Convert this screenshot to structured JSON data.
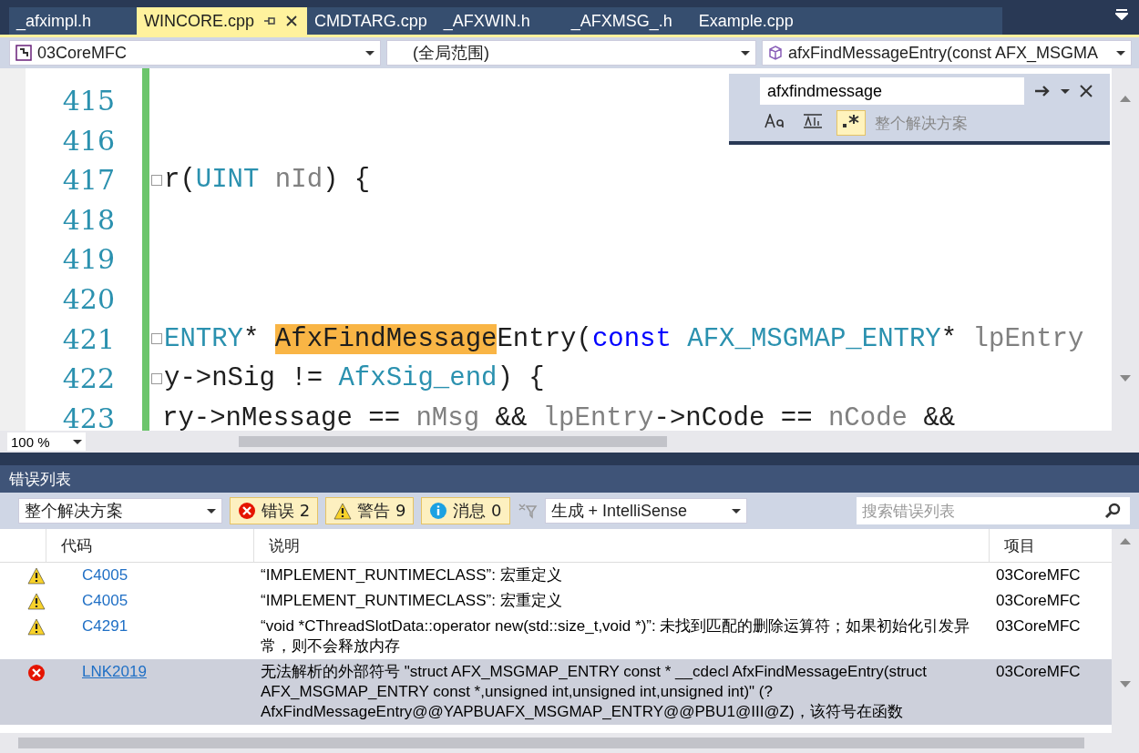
{
  "tabs": [
    {
      "label": "_afximpl.h",
      "selected": false
    },
    {
      "label": "WINCORE.cpp",
      "selected": true
    },
    {
      "label": "CMDTARG.cpp",
      "selected": false
    },
    {
      "label": "_AFXWIN.h",
      "selected": false
    },
    {
      "label": "_AFXMSG_.h",
      "selected": false
    },
    {
      "label": "Example.cpp",
      "selected": false
    }
  ],
  "nav": {
    "project": "03CoreMFC",
    "scope": "(全局范围)",
    "member": "afxFindMessageEntry(const AFX_MSGMA"
  },
  "editor": {
    "zoom": "100 %",
    "lines": [
      {
        "number": "415",
        "fold": false
      },
      {
        "number": "416",
        "fold": false
      },
      {
        "number": "417",
        "fold": true,
        "segments": [
          {
            "kind": "plain",
            "text": "r("
          },
          {
            "kind": "type",
            "text": "UINT"
          },
          {
            "kind": "param",
            "text": " nId"
          },
          {
            "kind": "plain",
            "text": ") {"
          }
        ]
      },
      {
        "number": "418",
        "fold": false
      },
      {
        "number": "419",
        "fold": false
      },
      {
        "number": "420",
        "fold": false
      },
      {
        "number": "421",
        "fold": true,
        "segments": [
          {
            "kind": "type",
            "text": "ENTRY"
          },
          {
            "kind": "plain",
            "text": "* "
          },
          {
            "kind": "match",
            "text": "AfxFindMessage"
          },
          {
            "kind": "plain",
            "text": "Entry("
          },
          {
            "kind": "keyword",
            "text": "const"
          },
          {
            "kind": "type",
            "text": " AFX_MSGMAP_ENTRY"
          },
          {
            "kind": "plain",
            "text": "* "
          },
          {
            "kind": "param",
            "text": "lpEntry"
          }
        ]
      },
      {
        "number": "422",
        "fold": true,
        "segments": [
          {
            "kind": "plain",
            "text": "y->nSig != "
          },
          {
            "kind": "type",
            "text": "AfxSig_end"
          },
          {
            "kind": "plain",
            "text": ") {"
          }
        ]
      },
      {
        "number": "423",
        "fold": false,
        "segments": [
          {
            "kind": "plain",
            "text": "ry->nMessage == "
          },
          {
            "kind": "param",
            "text": "nMsg"
          },
          {
            "kind": "plain",
            "text": " && "
          },
          {
            "kind": "param",
            "text": "lpEntry"
          },
          {
            "kind": "plain",
            "text": "->nCode == "
          },
          {
            "kind": "param",
            "text": "nCode"
          },
          {
            "kind": "plain",
            "text": " &&"
          }
        ]
      }
    ]
  },
  "find": {
    "value": "afxfindmessage",
    "scope": "整个解决方案",
    "match_case": false,
    "whole_word": false,
    "regex": true
  },
  "error_list": {
    "title": "错误列表",
    "scope": "整个解决方案",
    "filters": [
      {
        "kind": "error",
        "label": "错误 2",
        "selected": true
      },
      {
        "kind": "warning",
        "label": "警告 9",
        "selected": true
      },
      {
        "kind": "info",
        "label": "消息 0",
        "selected": true
      }
    ],
    "source": "生成 + IntelliSense",
    "search": {
      "placeholder": "搜索错误列表"
    },
    "columns": [
      "代码",
      "说明",
      "项目"
    ],
    "rows": [
      {
        "kind": "warning",
        "code": "C4005",
        "description": "“IMPLEMENT_RUNTIMECLASS”: 宏重定义",
        "project": "03CoreMFC",
        "selected": false
      },
      {
        "kind": "warning",
        "code": "C4005",
        "description": "“IMPLEMENT_RUNTIMECLASS”: 宏重定义",
        "project": "03CoreMFC",
        "selected": false
      },
      {
        "kind": "warning",
        "code": "C4291",
        "description": "“void *CThreadSlotData::operator new(std::size_t,void *)”: 未找到匹配的删除运算符；如果初始化引发异常，则不会释放内存",
        "project": "03CoreMFC",
        "selected": false
      },
      {
        "kind": "error",
        "code": "LNK2019",
        "description": "无法解析的外部符号 \"struct AFX_MSGMAP_ENTRY const * __cdecl AfxFindMessageEntry(struct AFX_MSGMAP_ENTRY const *,unsigned int,unsigned int,unsigned int)\" (?AfxFindMessageEntry@@YAPBUAFX_MSGMAP_ENTRY@@PBU1@III@Z)，该符号在函数",
        "project": "03CoreMFC",
        "selected": true
      }
    ]
  }
}
